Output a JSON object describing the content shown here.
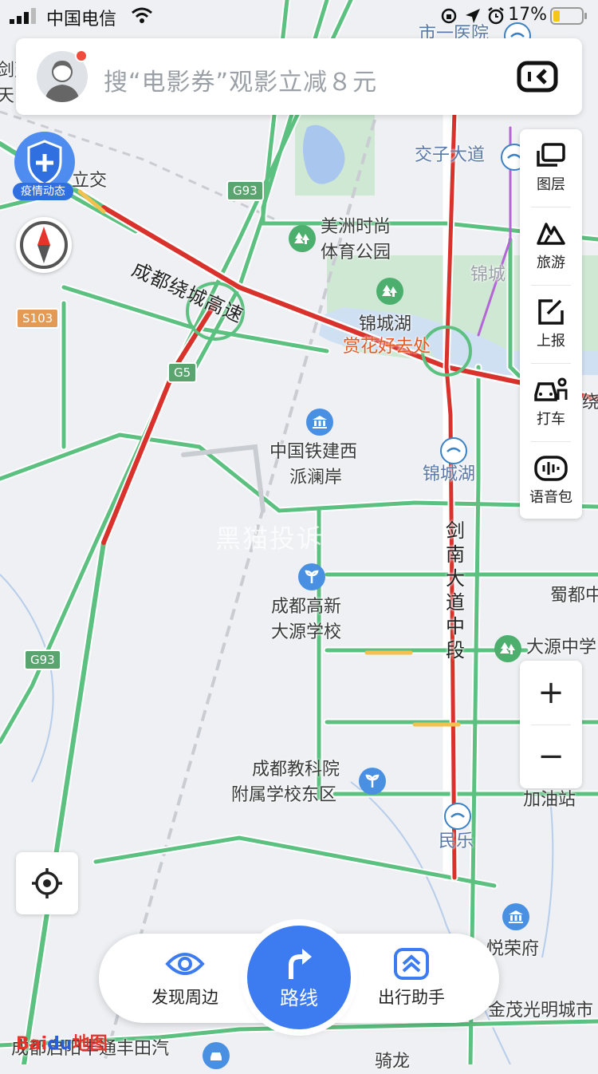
{
  "status_bar": {
    "carrier": "中国电信",
    "battery": "17%"
  },
  "search": {
    "placeholder": "搜“电影券”观影立减８元"
  },
  "widgets": {
    "epidemic_label": "疫情动态"
  },
  "toolbar": [
    {
      "label": "图层",
      "icon": "layers-icon"
    },
    {
      "label": "旅游",
      "icon": "travel-icon"
    },
    {
      "label": "上报",
      "icon": "report-icon"
    },
    {
      "label": "打车",
      "icon": "taxi-icon"
    },
    {
      "label": "语音包",
      "icon": "voice-pack-icon"
    }
  ],
  "zoom": {
    "in": "+",
    "out": "−"
  },
  "bottom_nav": {
    "discover": "发现周边",
    "route": "路线",
    "assistant": "出行助手"
  },
  "logo": {
    "bai": "Bai",
    "du": "du",
    "map": "地图"
  },
  "watermark": "黑猫投诉",
  "map": {
    "road_names": {
      "ring_expressway": "成都绕城高速",
      "jiannan_road": "剑南大道中段"
    },
    "shields": {
      "g93_top": "G93",
      "g5": "G5",
      "s103": "S103",
      "g93_bottom": "G93"
    },
    "labels": {
      "hospital": "市一医院",
      "jiaozi": "交子大道",
      "li_jiao": "立交",
      "meizhou_1": "美洲时尚",
      "meizhou_2": "体育公园",
      "jincheng_edge": "锦城",
      "jincheng_lake": "锦城湖",
      "flowers": "赏花好去处",
      "rao": "绕",
      "crcc_1": "中国铁建西",
      "crcc_2": "派澜岸",
      "jincheng_metro": "锦城湖",
      "shudu": "蜀都中",
      "gaoxin_1": "成都高新",
      "gaoxin_2": "大源学校",
      "dayuan": "大源中学",
      "jky_1": "成都教科院",
      "jky_2": "附属学校东区",
      "gas": "加油站",
      "minle": "民乐",
      "yuerong": "悦荣府",
      "jinmao": "金茂光明城市",
      "toyota": "成都启阳丰通丰田汽",
      "jilong": "骑龙",
      "left_edge_1": "剑建",
      "left_edge_2": "天弓"
    }
  }
}
